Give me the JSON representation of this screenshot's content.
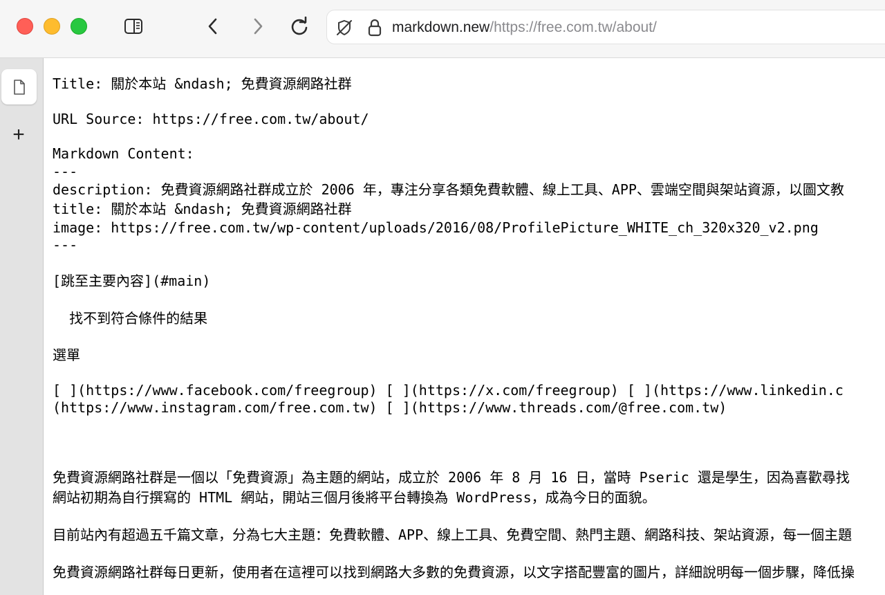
{
  "toolbar": {
    "url_host": "markdown.new",
    "url_path": "/https://free.com.tw/about/",
    "icons": [
      "sidebar-toggle-icon",
      "back-arrow-icon",
      "forward-arrow-icon",
      "reload-icon",
      "privacy-shield-icon",
      "lock-icon"
    ]
  },
  "sidebar": {
    "icons": [
      "document-icon",
      "plus-icon"
    ],
    "new_tab_glyph": "+"
  },
  "content": {
    "title_line": "Title: 關於本站 &ndash; 免費資源網路社群",
    "url_source_line": "URL Source: https://free.com.tw/about/",
    "markdown_label": "Markdown Content:",
    "frontmatter_open": "---",
    "description_line": "description: 免費資源網路社群成立於 2006 年，專注分享各類免費軟體、線上工具、APP、雲端空間與架站資源，以圖文教",
    "fm_title_line": "title: 關於本站 &ndash; 免費資源網路社群",
    "image_line": "image: https://free.com.tw/wp-content/uploads/2016/08/ProfilePicture_WHITE_ch_320x320_v2.png",
    "frontmatter_close": "---",
    "skip_link": "[跳至主要內容](#main)",
    "no_results": "  找不到符合條件的結果",
    "menu": "選單",
    "social_line_1": "[ ](https://www.facebook.com/freegroup) [ ](https://x.com/freegroup) [ ](https://www.linkedin.c",
    "social_line_2": "(https://www.instagram.com/free.com.tw) [ ](https://www.threads.com/@free.com.tw)",
    "para1_line1": "免費資源網路社群是一個以「免費資源」為主題的網站，成立於 2006 年 8 月 16 日，當時 Pseric 還是學生，因為喜歡尋找",
    "para1_line2": "網站初期為自行撰寫的 HTML 網站，開站三個月後將平台轉換為 WordPress，成為今日的面貌。",
    "para2": "目前站內有超過五千篇文章，分為七大主題：免費軟體、APP、線上工具、免費空間、熱門主題、網路科技、架站資源，每一個主題",
    "para3": "免費資源網路社群每日更新，使用者在這裡可以找到網路大多數的免費資源，以文字搭配豐富的圖片，詳細說明每一個步驟，降低操"
  },
  "colors": {
    "traffic_red": "#ff5f57",
    "traffic_yellow": "#febc2e",
    "traffic_green": "#28c840",
    "url_path_gray": "#8a8a8e"
  }
}
